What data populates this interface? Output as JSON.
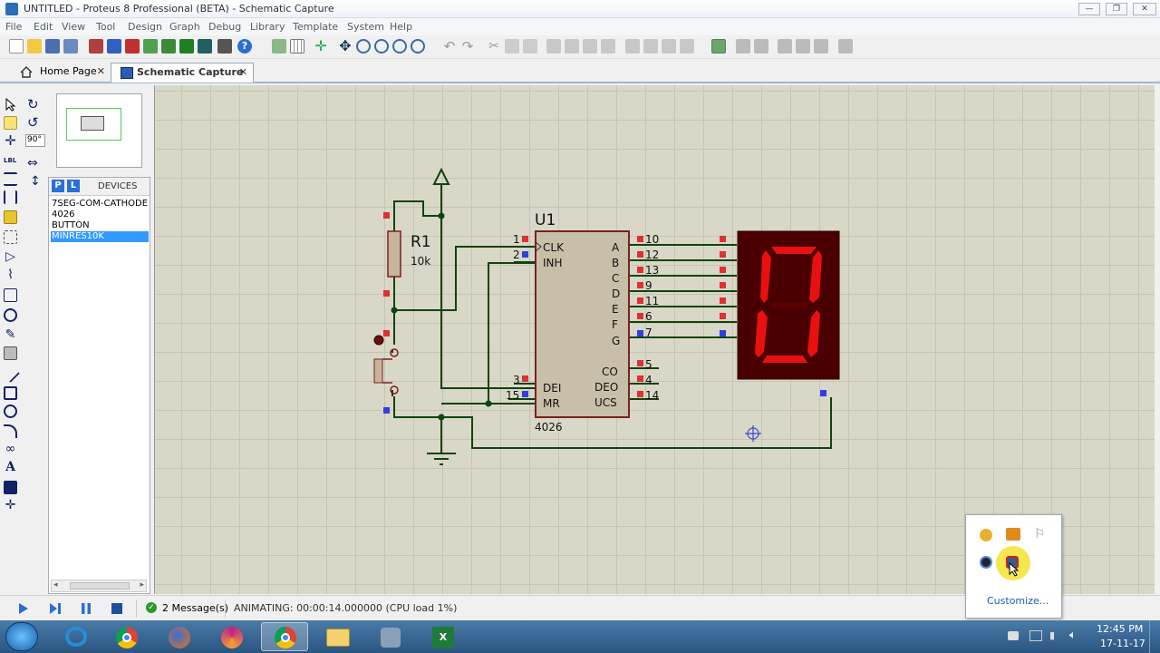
{
  "window": {
    "title": "UNTITLED - Proteus 8 Professional (BETA) - Schematic Capture"
  },
  "menu": [
    "File",
    "Edit",
    "View",
    "Tool",
    "Design",
    "Graph",
    "Debug",
    "Library",
    "Template",
    "System",
    "Help"
  ],
  "tabs": [
    {
      "label": "Home Page"
    },
    {
      "label": "Schematic Capture"
    }
  ],
  "rotation": {
    "value": "90°"
  },
  "devices": {
    "header": "DEVICES",
    "p_label": "P",
    "l_label": "L",
    "items": [
      "7SEG-COM-CATHODE",
      "4026",
      "BUTTON",
      "MINRES10K"
    ],
    "selected": "MINRES10K"
  },
  "schematic": {
    "r1": {
      "ref": "R1",
      "value": "10k"
    },
    "u1": {
      "ref": "U1",
      "part": "4026",
      "left_pins": [
        {
          "num": "1",
          "name": "CLK"
        },
        {
          "num": "2",
          "name": "INH"
        },
        {
          "num": "3",
          "name": "DEI"
        },
        {
          "num": "15",
          "name": "MR"
        }
      ],
      "right_pins": [
        {
          "num": "10",
          "name": "A"
        },
        {
          "num": "12",
          "name": "B"
        },
        {
          "num": "13",
          "name": "C"
        },
        {
          "num": "9",
          "name": "D"
        },
        {
          "num": "11",
          "name": "E"
        },
        {
          "num": "6",
          "name": "F"
        },
        {
          "num": "7",
          "name": "G"
        },
        {
          "num": "5",
          "name": "CO"
        },
        {
          "num": "4",
          "name": "DEO"
        },
        {
          "num": "14",
          "name": "UCS"
        }
      ]
    },
    "display_digit": "0",
    "segment_color": "#e81010",
    "display_bg": "#4a0000"
  },
  "status": {
    "messages": "2 Message(s)",
    "animating": "ANIMATING: 00:00:14.000000 (CPU load 1%)"
  },
  "tray_popup": {
    "customize": "Customize..."
  },
  "clock": {
    "time": "12:45 PM",
    "date": "17-11-17"
  }
}
